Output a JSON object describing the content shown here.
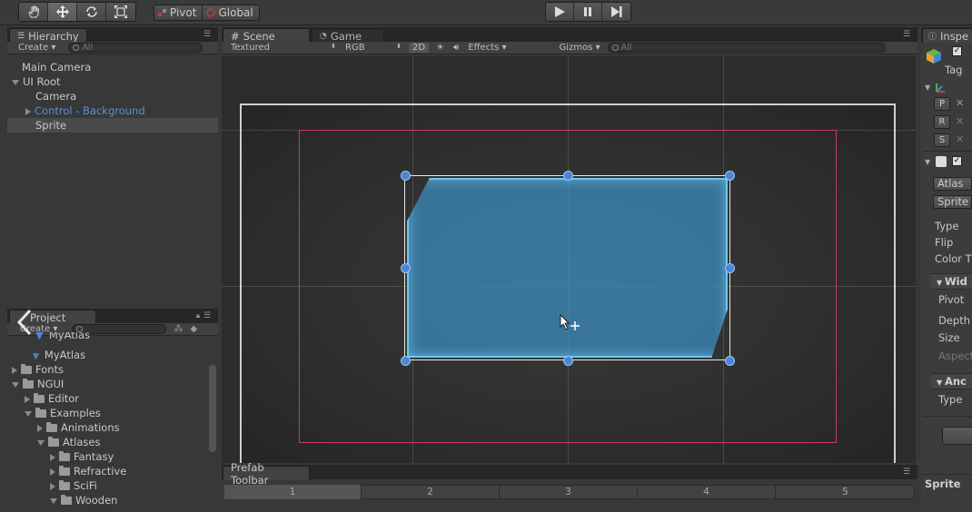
{
  "toolbar": {
    "tools": [
      "hand-tool-icon",
      "move-tool-icon",
      "rotate-tool-icon",
      "scale-tool-icon"
    ],
    "pivot_label": "Pivot",
    "global_label": "Global"
  },
  "hierarchy": {
    "tab_label": "Hierarchy",
    "create_label": "Create",
    "search_placeholder": "All",
    "items": [
      {
        "label": "Main Camera"
      },
      {
        "label": "UI Root"
      },
      {
        "label": "Camera"
      },
      {
        "label": "Control - Background"
      },
      {
        "label": "Sprite"
      }
    ]
  },
  "scene": {
    "tab_label": "Scene",
    "game_tab_label": "Game",
    "render_mode": "Textured",
    "color_mode": "RGB",
    "toggle_2d": "2D",
    "effects_label": "Effects",
    "gizmos_label": "Gizmos",
    "search_placeholder": "All"
  },
  "project": {
    "tab_label": "Project",
    "create_label": "Create",
    "items": [
      {
        "label": "MyAtlas"
      },
      {
        "label": "MyAtlas"
      },
      {
        "label": "Fonts"
      },
      {
        "label": "NGUI"
      },
      {
        "label": "Editor"
      },
      {
        "label": "Examples"
      },
      {
        "label": "Animations"
      },
      {
        "label": "Atlases"
      },
      {
        "label": "Fantasy"
      },
      {
        "label": "Refractive"
      },
      {
        "label": "SciFi"
      },
      {
        "label": "Wooden"
      }
    ]
  },
  "inspector": {
    "tab_label": "Inspe",
    "tag_label": "Tag",
    "transform_buttons": [
      "P",
      "R",
      "S"
    ],
    "atlas_button": "Atlas",
    "sprite_button": "Sprite",
    "labels": [
      "Type",
      "Flip",
      "Color T"
    ],
    "widget_section": "Wid",
    "widget_labels": [
      "Pivot",
      "Depth",
      "Size",
      "Aspect"
    ],
    "anchor_section": "Anc",
    "anchor_type_label": "Type",
    "bottom_label": "Sprite"
  },
  "prefab_toolbar": {
    "tab_label": "Prefab Toolbar",
    "pages": [
      "1",
      "2",
      "3",
      "4",
      "5"
    ]
  },
  "colors": {
    "selection_link": "#5d8fd8",
    "sprite_blue": "#4a86d8",
    "game_rect": "#c83c55"
  }
}
